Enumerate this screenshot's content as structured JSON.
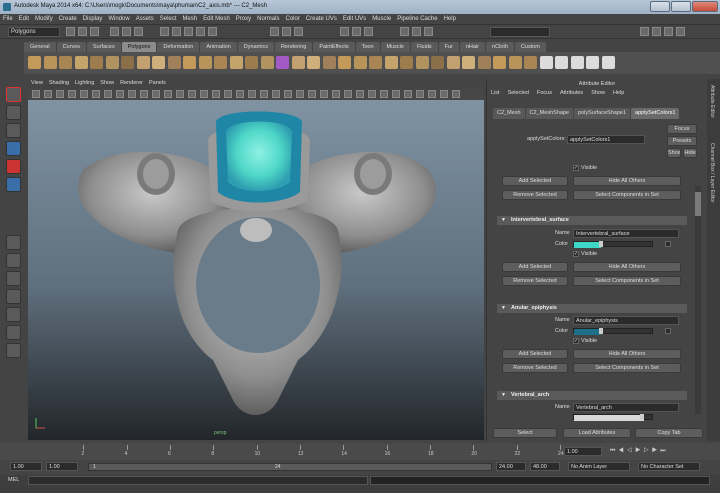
{
  "window": {
    "title": "Autodesk Maya 2014 x64: C:\\Users\\mogk\\Documents\\maya\\phuman\\C2_axis.mb* --- C2_Mesh"
  },
  "menubar": [
    "File",
    "Edit",
    "Modify",
    "Create",
    "Display",
    "Window",
    "Assets",
    "Select",
    "Mesh",
    "Edit Mesh",
    "Proxy",
    "Normals",
    "Color",
    "Create UVs",
    "Edit UVs",
    "Muscle",
    "Pipeline Cache",
    "Help"
  ],
  "statusline": {
    "mode": "Polygons"
  },
  "shelf": {
    "tabs": [
      "General",
      "Curves",
      "Surfaces",
      "Polygons",
      "Deformation",
      "Animation",
      "Dynamics",
      "Rendering",
      "PaintEffects",
      "Toon",
      "Muscle",
      "Fluids",
      "Fur",
      "nHair",
      "nCloth",
      "Custom"
    ],
    "active": "Polygons"
  },
  "viewport": {
    "menu": [
      "View",
      "Shading",
      "Lighting",
      "Show",
      "Renderer",
      "Panels"
    ],
    "status": "persp"
  },
  "attribute_editor": {
    "title": "Attribute Editor",
    "menu": [
      "List",
      "Selected",
      "Focus",
      "Attributes",
      "Show",
      "Help"
    ],
    "tabs": [
      "C2_Mesh",
      "C2_MeshShape",
      "polySurfaceShape1",
      "applySetColors1"
    ],
    "active_tab": "applySetColors1",
    "node_label": "applySetColors:",
    "node_value": "applySetColors1",
    "focus": "Focus",
    "presets": "Presets",
    "show": "Show",
    "hide": "Hide",
    "visible_label": "Visible",
    "add_selected": "Add Selected",
    "hide_all_others": "Hide All Others",
    "remove_selected": "Remove Selected",
    "select_components": "Select Components in Set",
    "name_label": "Name",
    "color_label": "Color",
    "sets": [
      {
        "title": "Intervertebral_surface",
        "name": "Intervertebral_surface",
        "color": "#3fd6c8",
        "fill": 0.35
      },
      {
        "title": "Anular_epiphysis",
        "name": "Anular_epiphysis",
        "color": "#1e6f8a",
        "fill": 0.35
      },
      {
        "title": "Vertebral_arch",
        "name": "Vertebral_arch",
        "color": "#d9d9d9",
        "fill": 0.9
      }
    ],
    "bottom_buttons": [
      "Select",
      "Load Attributes",
      "Copy Tab"
    ]
  },
  "side_tabs": [
    "Attribute Editor",
    "Channel Box / Layer Editor"
  ],
  "timeline": {
    "ticks": [
      "2",
      "4",
      "6",
      "8",
      "10",
      "12",
      "14",
      "16",
      "18",
      "20",
      "22",
      "24"
    ],
    "current": "1.00"
  },
  "range": {
    "start": "1.00",
    "start2": "1.00",
    "slider_start": "1",
    "slider_end": "24",
    "end": "24.00",
    "end2": "48.00",
    "anim_layer": "No Anim Layer",
    "char_set": "No Character Set"
  },
  "cmdline": {
    "label": "MEL"
  }
}
